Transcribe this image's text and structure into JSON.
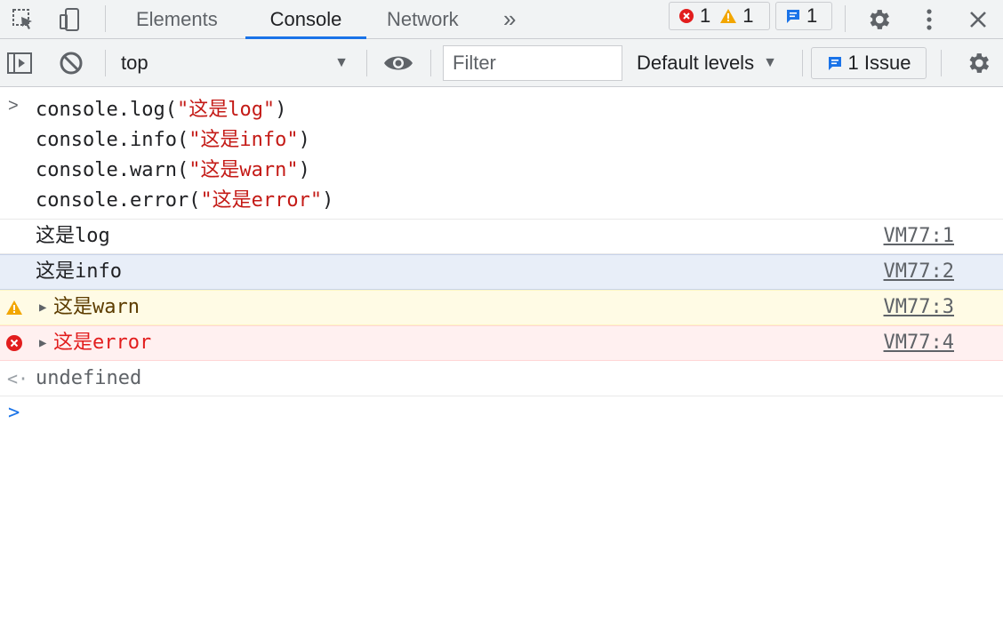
{
  "tabbar": {
    "tabs": [
      {
        "label": "Elements",
        "active": false
      },
      {
        "label": "Console",
        "active": true
      },
      {
        "label": "Network",
        "active": false
      }
    ],
    "more_tabs_glyph": "»",
    "counts": {
      "errors": "1",
      "warnings": "1",
      "messages": "1"
    },
    "icons": [
      "inspect-element-icon",
      "device-toolbar-icon",
      "more-tabs-icon",
      "settings-gear-icon",
      "kebab-menu-icon",
      "close-icon"
    ]
  },
  "toolbar": {
    "context": "top",
    "filter_placeholder": "Filter",
    "levels_label": "Default levels",
    "issues_label": "1 Issue",
    "icons": [
      "sidebar-toggle-icon",
      "clear-console-icon",
      "eye-icon",
      "console-settings-gear-icon"
    ]
  },
  "console": {
    "command": {
      "lines": [
        {
          "pre": "console.log(",
          "str": "\"这是log\"",
          "post": ")"
        },
        {
          "pre": "console.info(",
          "str": "\"这是info\"",
          "post": ")"
        },
        {
          "pre": "console.warn(",
          "str": "\"这是warn\"",
          "post": ")"
        },
        {
          "pre": "console.error(",
          "str": "\"这是error\"",
          "post": ")"
        }
      ]
    },
    "messages": [
      {
        "level": "log",
        "text": "这是log",
        "source": "VM77:1"
      },
      {
        "level": "info",
        "text": "这是info",
        "source": "VM77:2"
      },
      {
        "level": "warn",
        "text": "这是warn",
        "source": "VM77:3"
      },
      {
        "level": "error",
        "text": "这是error",
        "source": "VM77:4"
      }
    ],
    "result": "undefined"
  },
  "colors": {
    "accent": "#1a73e8",
    "string": "#c41a16",
    "warn_bg": "#fffbe5",
    "warn_icon": "#f2a600",
    "error_bg": "#fff0f0",
    "error_icon": "#e21d1d",
    "info_bg": "#e8eef8"
  }
}
